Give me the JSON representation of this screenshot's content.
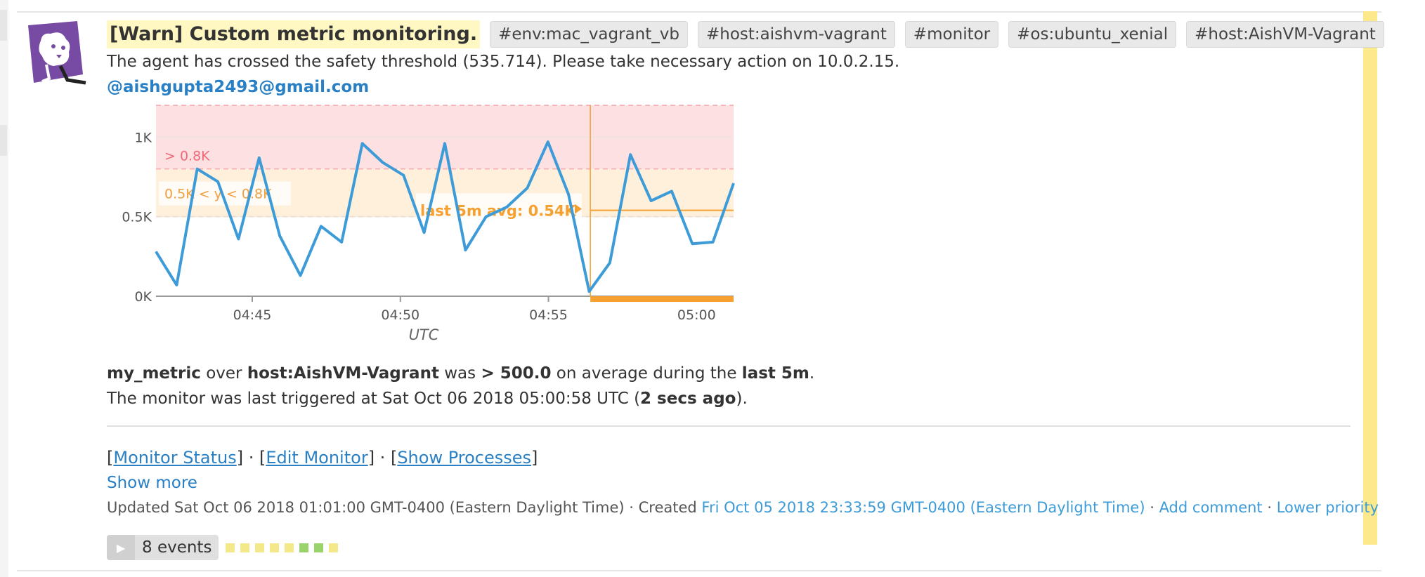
{
  "event": {
    "title": "[Warn] Custom metric monitoring.",
    "tags": [
      "#env:mac_vagrant_vb",
      "#host:aishvm-vagrant",
      "#monitor",
      "#os:ubuntu_xenial",
      "#host:AishVM-Vagrant"
    ],
    "message": "The agent has crossed the safety threshold (535.714). Please take necessary action on 10.0.2.15.",
    "mention": "@aishgupta2493@gmail.com",
    "severity_color": "#fbe98b"
  },
  "chart_data": {
    "type": "line",
    "x": [
      "04:41",
      "04:41:30",
      "04:42",
      "04:42:30",
      "04:43",
      "04:43:30",
      "04:44",
      "04:44:30",
      "04:45",
      "04:45:30",
      "04:46",
      "04:46:30",
      "04:47",
      "04:47:30",
      "04:48",
      "04:48:30",
      "04:49",
      "04:49:30",
      "04:50",
      "04:50:30",
      "04:51",
      "04:51:30",
      "04:52",
      "04:52:30",
      "04:53",
      "04:53:30",
      "04:54",
      "04:54:30",
      "04:55",
      "04:55:30",
      "04:56",
      "04:56:30",
      "04:57",
      "04:57:30",
      "04:58",
      "04:58:30",
      "04:59",
      "04:59:30",
      "05:00",
      "05:00:30"
    ],
    "series": [
      {
        "values": [
          280,
          70,
          800,
          720,
          360,
          870,
          380,
          130,
          440,
          340,
          960,
          840,
          760,
          400,
          960,
          290,
          500,
          560,
          680,
          970,
          640,
          30,
          210,
          890,
          600,
          660,
          330,
          340,
          710
        ]
      }
    ],
    "xticks": [
      "04:45",
      "04:50",
      "04:55",
      "05:00"
    ],
    "yticks": [
      "0K",
      "0.5K",
      "1K"
    ],
    "xlabel": "UTC",
    "ylim": [
      0,
      1200
    ],
    "thresholds": {
      "critical_label": "> 0.8K",
      "warning_label": "0.5K < y < 0.8K",
      "critical": 800,
      "warning": 500
    },
    "avg_label": "last 5m avg: 0.54K",
    "avg_value": 540,
    "colors": {
      "line": "#3d9bd8",
      "critical": "#fde0e2",
      "warning": "#fff0dc",
      "marker": "#f5a030"
    }
  },
  "summary": {
    "metric": "my_metric",
    "over": " over ",
    "scope": "host:AishVM-Vagrant",
    "was": " was ",
    "condition": "> 500.0",
    "avg_text": " on average during the ",
    "window": "last 5m",
    "period": ".",
    "triggered_prefix": "The monitor was last triggered at Sat Oct 06 2018 05:00:58 UTC (",
    "triggered_ago": "2 secs ago",
    "triggered_suffix": ")."
  },
  "links": {
    "monitor_status": "Monitor Status",
    "edit_monitor": "Edit Monitor",
    "show_processes": "Show Processes",
    "show_more": "Show more"
  },
  "meta": {
    "updated": "Updated Sat Oct 06 2018 01:01:00 GMT-0400 (Eastern Daylight Time) · Created ",
    "created": "Fri Oct 05 2018 23:33:59 GMT-0400 (Eastern Daylight Time)",
    "add_comment": "Add comment",
    "lower_priority": "Lower priority"
  },
  "events": {
    "label": "8 events",
    "squares": [
      "#f3e88a",
      "#f3e88a",
      "#f3e88a",
      "#f3e88a",
      "#f3e88a",
      "#9ad36a",
      "#9ad36a",
      "#f3e88a"
    ]
  }
}
